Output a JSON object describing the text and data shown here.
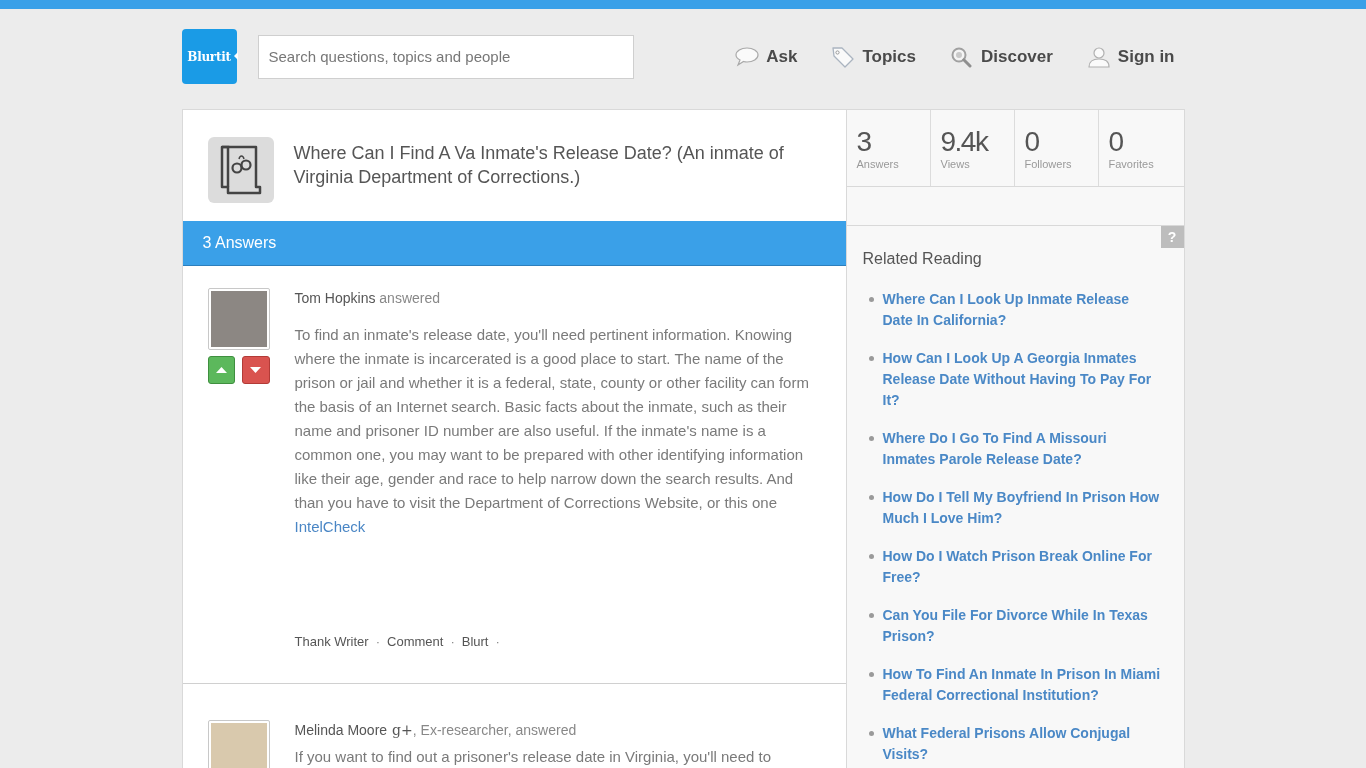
{
  "header": {
    "logo": "Blurtit",
    "search": {
      "placeholder": "Search questions, topics and people"
    },
    "nav": [
      {
        "kind": "speech",
        "label": "Ask"
      },
      {
        "kind": "tag",
        "label": "Topics"
      },
      {
        "kind": "magnifier",
        "label": "Discover"
      },
      {
        "kind": "person",
        "label": "Sign in"
      }
    ]
  },
  "question": {
    "title": "Where Can I Find A Va Inmate's Release Date? (An inmate of Virginia Department of Corrections.)",
    "answers_heading": "3 Answers"
  },
  "answers": [
    {
      "author": "Tom Hopkins",
      "suffix": "answered",
      "body": [
        {
          "kind": "text",
          "text": "To find an inmate's release date, you'll need pertinent information. Knowing where the inmate is incarcerated is a good place to start. The name of the prison or jail and whether it is a federal, state, county or other facility can form the basis of an Internet search. Basic facts about the inmate, such as their name and prisoner ID number are also useful. If the inmate's name is a common one, you may want to be prepared with other identifying information like their age, gender and race to help narrow down the search results. And than you have to visit the Department of Corrections Website, or this one "
        },
        {
          "kind": "link",
          "text": "IntelCheck"
        }
      ],
      "actions": [
        "Thank Writer",
        "Comment",
        "Blurt"
      ],
      "separator": "·"
    },
    {
      "author": "Melinda Moore",
      "badge": "g+",
      "suffix": ", Ex-researcher, answered",
      "body": [
        {
          "kind": "text",
          "text": "If you want to find out a prisoner's release date in Virginia, you'll need to"
        }
      ]
    }
  ],
  "stats": [
    {
      "value": "3",
      "label": "Answers"
    },
    {
      "value": "9.4k",
      "label": "Views"
    },
    {
      "value": "0",
      "label": "Followers"
    },
    {
      "value": "0",
      "label": "Favorites"
    }
  ],
  "related": {
    "help": "?",
    "title": "Related Reading",
    "items": [
      "Where Can I Look Up Inmate Release Date In California?",
      "How Can I Look Up A Georgia Inmates Release Date Without Having To Pay For It?",
      "Where Do I Go To Find A Missouri Inmates Parole Release Date?",
      "How Do I Tell My Boyfriend In Prison How Much I Love Him?",
      "How Do I Watch Prison Break Online For Free?",
      "Can You File For Divorce While In Texas Prison?",
      "How To Find An Inmate In Prison In Miami Federal Correctional Institution?",
      "What Federal Prisons Allow Conjugal Visits?"
    ]
  }
}
